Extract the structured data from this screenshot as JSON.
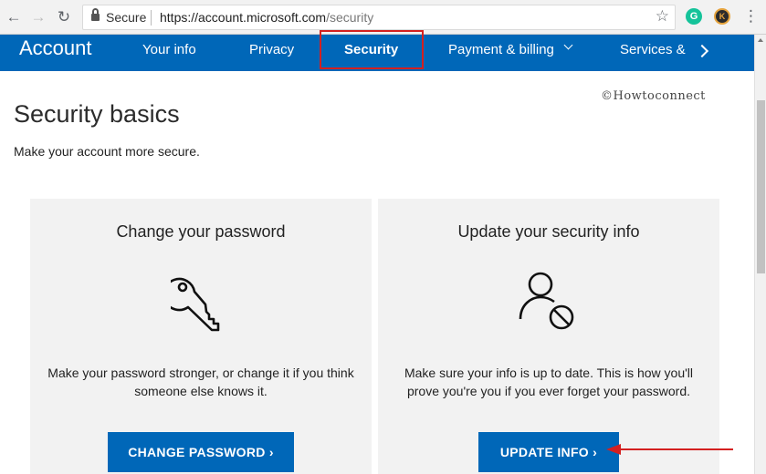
{
  "browser": {
    "security_label": "Secure",
    "url_host": "https://account.microsoft.com",
    "url_path": "/security",
    "icons": [
      "back-arrow-icon",
      "forward-arrow-icon",
      "reload-icon",
      "lock-icon",
      "star-icon",
      "grammarly-extension-icon",
      "k-extension-icon",
      "menu-dots-icon"
    ],
    "extension_g": "G",
    "extension_k": "K"
  },
  "nav": {
    "brand": "Account",
    "items": [
      {
        "label": "Your info"
      },
      {
        "label": "Privacy"
      },
      {
        "label": "Security",
        "active": true
      },
      {
        "label": "Payment & billing"
      },
      {
        "label": "Services &"
      }
    ],
    "color": "#0067b8",
    "highlight_color": "#d42020"
  },
  "watermark": "©Howtoconnect",
  "page": {
    "title": "Security basics",
    "subtitle": "Make your account more secure."
  },
  "cards": [
    {
      "title": "Change your password",
      "icon": "key-icon",
      "description": "Make your password stronger, or change it if you think someone else knows it.",
      "button": "CHANGE PASSWORD ›"
    },
    {
      "title": "Update your security info",
      "icon": "user-blocked-icon",
      "description": "Make sure your info is up to date. This is how you'll prove you're you if you ever forget your password.",
      "button": "UPDATE INFO ›"
    }
  ],
  "annotation_arrow_color": "#d42020"
}
